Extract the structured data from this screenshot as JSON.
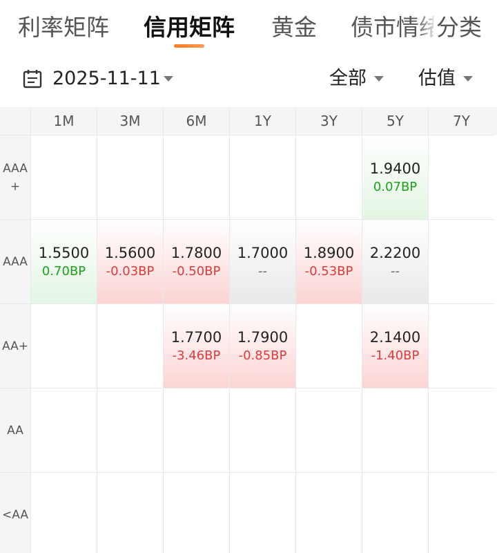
{
  "tabs": [
    "利率矩阵",
    "信用矩阵",
    "黄金",
    "债市情绪",
    "分类"
  ],
  "active_tab": "信用矩阵",
  "filters": {
    "date": "2025-11-11",
    "scope": "全部",
    "metric": "估值"
  },
  "columns": [
    "1M",
    "3M",
    "6M",
    "1Y",
    "3Y",
    "5Y",
    "7Y"
  ],
  "rows": [
    {
      "label": "AAA\n+",
      "cells": [
        null,
        null,
        null,
        null,
        null,
        {
          "value": "1.9400",
          "change": "0.07BP",
          "trend": "up"
        },
        null
      ]
    },
    {
      "label": "AAA",
      "cells": [
        {
          "value": "1.5500",
          "change": "0.70BP",
          "trend": "up"
        },
        {
          "value": "1.5600",
          "change": "-0.03BP",
          "trend": "down"
        },
        {
          "value": "1.7800",
          "change": "-0.50BP",
          "trend": "down"
        },
        {
          "value": "1.7000",
          "change": "--",
          "trend": "flat"
        },
        {
          "value": "1.8900",
          "change": "-0.53BP",
          "trend": "down"
        },
        {
          "value": "2.2200",
          "change": "--",
          "trend": "flat"
        },
        null
      ]
    },
    {
      "label": "AA+",
      "cells": [
        null,
        null,
        {
          "value": "1.7700",
          "change": "-3.46BP",
          "trend": "down"
        },
        {
          "value": "1.7900",
          "change": "-0.85BP",
          "trend": "down"
        },
        null,
        {
          "value": "2.1400",
          "change": "-1.40BP",
          "trend": "down"
        },
        null
      ]
    },
    {
      "label": "AA",
      "cells": [
        null,
        null,
        null,
        null,
        null,
        null,
        null
      ]
    },
    {
      "label": "<AA",
      "cells": [
        null,
        null,
        null,
        null,
        null,
        null,
        null
      ]
    }
  ],
  "colors": {
    "accent": "#ff7a2a",
    "up": "#1aa31a",
    "down": "#e03a3a",
    "up_bg": "#e3f5e3",
    "down_bg": "#fcd4d4",
    "flat_bg": "#e9e9e9"
  }
}
